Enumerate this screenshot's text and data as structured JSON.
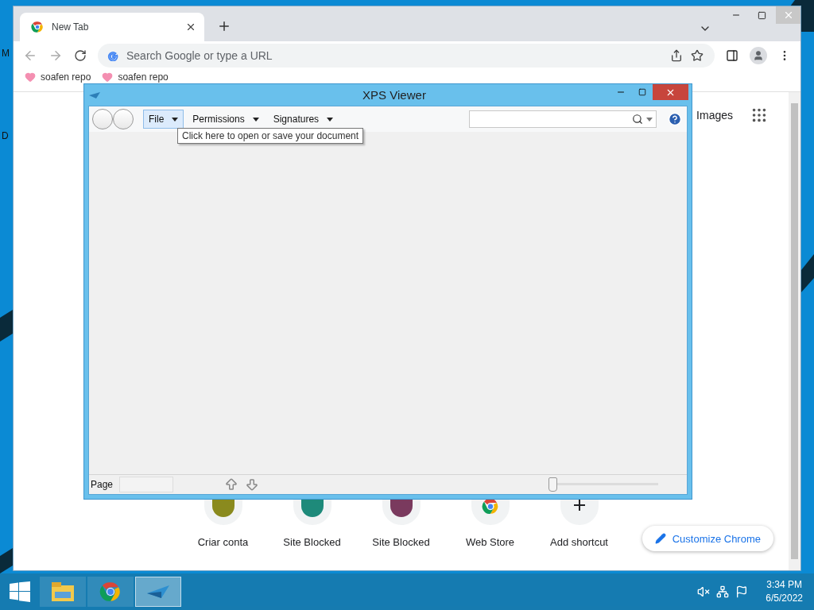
{
  "desktop": {
    "icon_labels": [
      "M",
      "D"
    ]
  },
  "browser": {
    "tab": {
      "title": "New Tab"
    },
    "address_bar": {
      "placeholder": "Search Google or type a URL"
    },
    "bookmarks": [
      "soafen repo",
      "soafen repo"
    ],
    "header_links": [
      "Images"
    ],
    "shortcuts": [
      {
        "kind": "letter",
        "label": "Criar conta",
        "color": "#8a8a1e"
      },
      {
        "kind": "letter",
        "label": "Site Blocked",
        "color": "#1e8a7a"
      },
      {
        "kind": "letter",
        "label": "Site Blocked",
        "color": "#7a3a5e"
      },
      {
        "kind": "store",
        "label": "Web Store"
      },
      {
        "kind": "add",
        "label": "Add shortcut"
      }
    ],
    "customize_button": "Customize Chrome"
  },
  "viewer": {
    "title": "XPS Viewer",
    "menus": [
      {
        "label": "File",
        "selected": true
      },
      {
        "label": "Permissions",
        "selected": false
      },
      {
        "label": "Signatures",
        "selected": false
      }
    ],
    "tooltip": "Click here to open or save your document",
    "status_bar": {
      "page_label": "Page",
      "zoom": {
        "level": 0.03
      }
    }
  },
  "taskbar": {
    "apps": [
      {
        "kind": "explorer",
        "selected": false
      },
      {
        "kind": "chrome",
        "selected": false
      },
      {
        "kind": "xps",
        "selected": true
      }
    ],
    "time": "3:34 PM",
    "date": "6/5/2022"
  }
}
